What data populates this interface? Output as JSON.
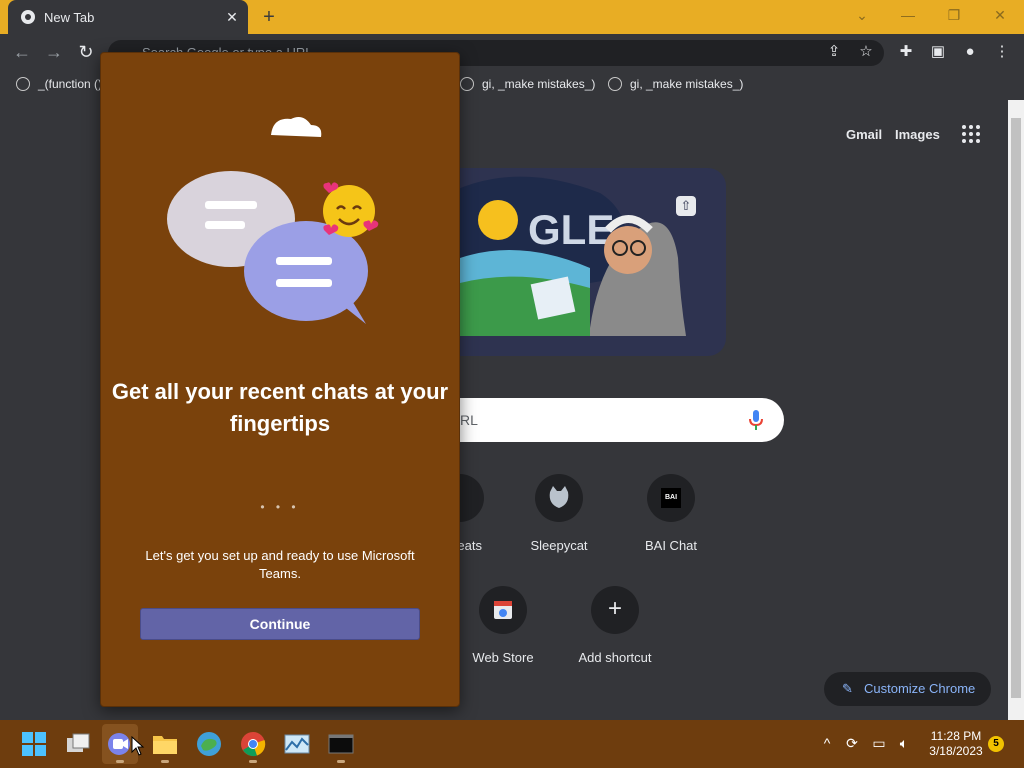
{
  "browser": {
    "tab_title": "New Tab",
    "tab_close": "✕",
    "new_tab": "+",
    "omnibox_placeholder": "Search Google or type a URL",
    "window_controls": [
      "⌄",
      "—",
      "❐",
      "✕"
    ]
  },
  "bookmarks": [
    {
      "label": "_(function ()"
    },
    {
      "label": "gi, _make mistakes_)"
    },
    {
      "label": "gi, _make mistakes_)"
    }
  ],
  "ntp": {
    "gmail": "Gmail",
    "images": "Images",
    "search_partial": "RL",
    "shortcuts_row1": [
      {
        "label": "eats"
      },
      {
        "label": "Sleepycat"
      },
      {
        "label": "BAI Chat",
        "icon_text": "BAI"
      }
    ],
    "shortcuts_row2": [
      {
        "label": "Web Store"
      },
      {
        "label": "Add shortcut",
        "icon_text": "+"
      }
    ],
    "customize": "Customize Chrome"
  },
  "popup": {
    "title": "Get all your recent chats at your fingertips",
    "dots": "• • •",
    "body": "Let's get you set up and ready to use Microsoft Teams.",
    "continue": "Continue"
  },
  "taskbar": {
    "time": "11:28 PM",
    "date": "3/18/2023",
    "notification_count": "5"
  },
  "colors": {
    "titlebar": "#e8ad24",
    "popup_bg": "#7a420c",
    "teams_accent": "#6264a7",
    "taskbar": "#6e3d0e"
  }
}
